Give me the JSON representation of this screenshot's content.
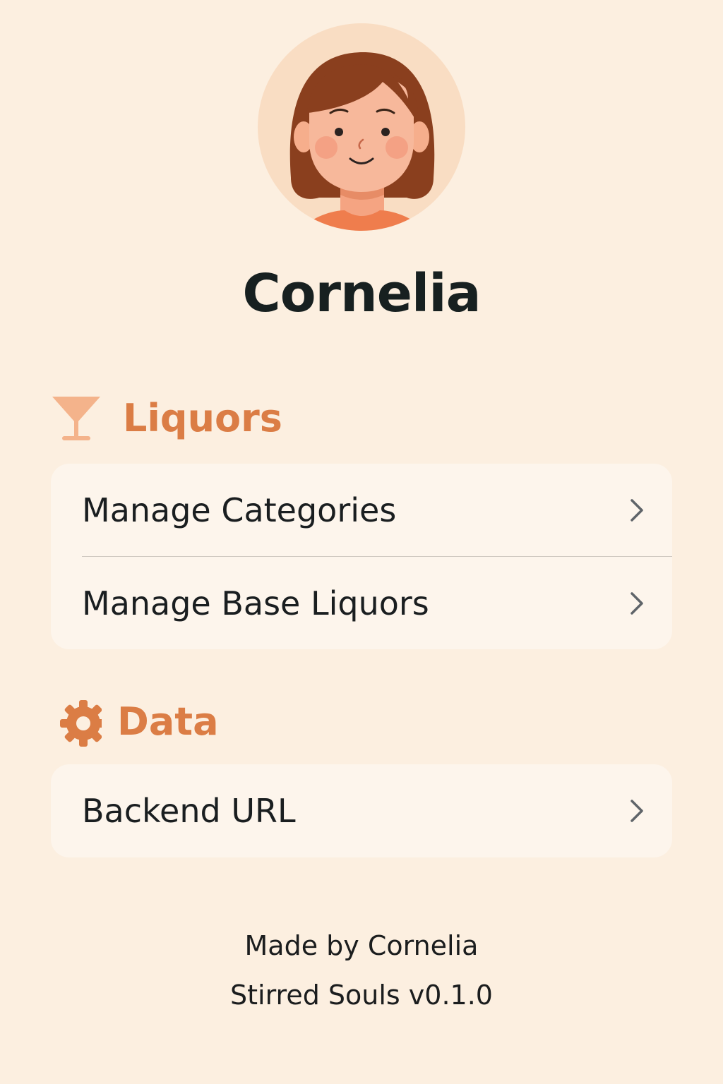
{
  "profile": {
    "name": "Cornelia",
    "avatar_icon": "woman-avatar-icon"
  },
  "sections": [
    {
      "title": "Liquors",
      "icon": "cocktail-glass-icon",
      "items": [
        {
          "label": "Manage Categories"
        },
        {
          "label": "Manage Base Liquors"
        }
      ]
    },
    {
      "title": "Data",
      "icon": "gear-icon",
      "items": [
        {
          "label": "Backend URL"
        }
      ]
    }
  ],
  "footer": {
    "credit": "Made by Cornelia",
    "version": "Stirred Souls v0.1.0"
  },
  "colors": {
    "background": "#fcefe0",
    "card": "#fdf5ec",
    "accent": "#db7d45",
    "text": "#1a1e20"
  }
}
